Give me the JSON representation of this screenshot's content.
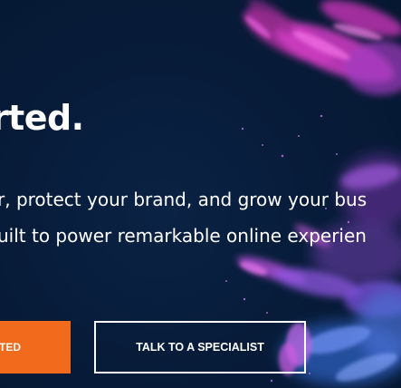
{
  "hero": {
    "headline": "tarted.",
    "subtext_line_1": "r, protect your brand, and grow your bus",
    "subtext_line_2": "uilt to power remarkable online experien",
    "primary_button_label": "TED",
    "secondary_button_label": "TALK TO A SPECIALIST"
  },
  "colors": {
    "background": "#061a35",
    "accent_orange": "#f26a1b",
    "text": "#ffffff",
    "powder_magenta": "#d93cc9",
    "powder_violet": "#8e4fd8",
    "powder_blue": "#3b6fd9"
  }
}
